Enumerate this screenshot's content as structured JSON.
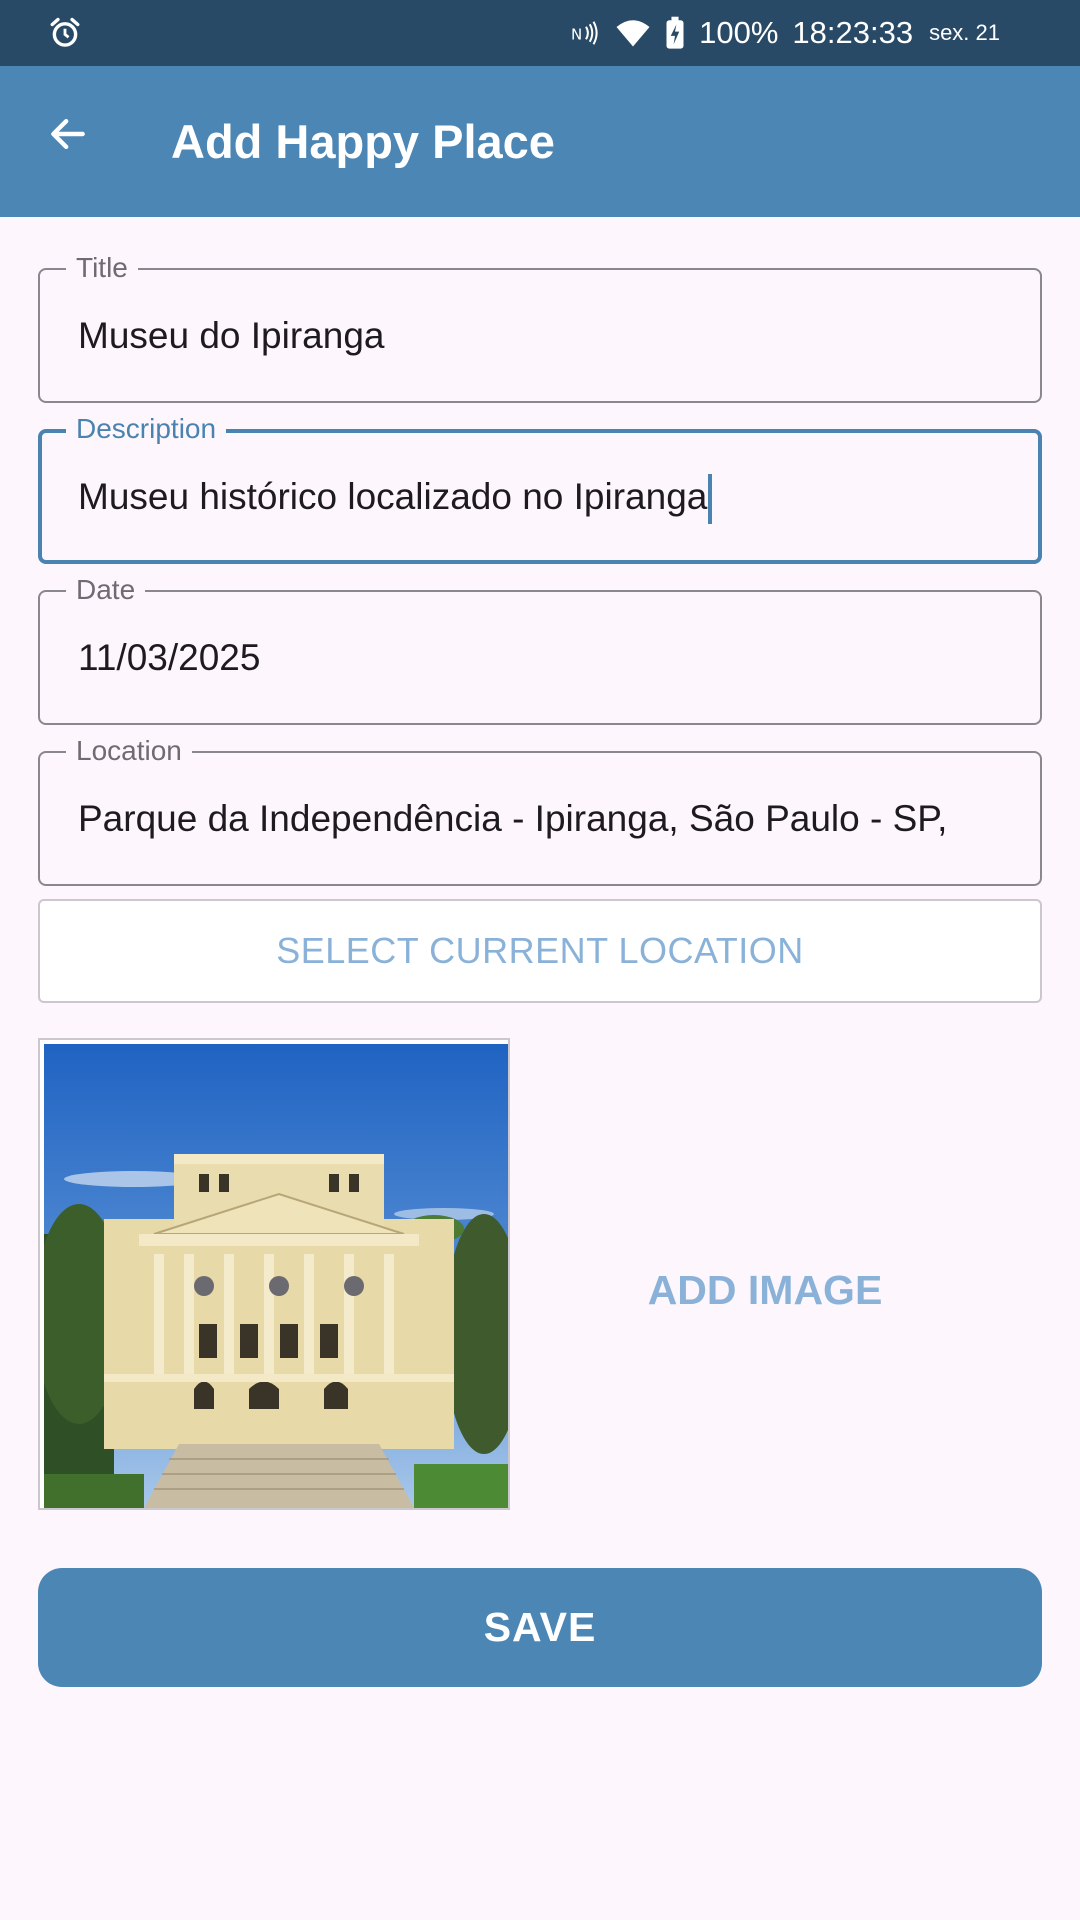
{
  "status_bar": {
    "time": "18:23:33",
    "date": "sex. 21",
    "battery": "100%",
    "icons": [
      "alarm-icon",
      "nfc-icon",
      "wifi-icon",
      "battery-charging-icon"
    ]
  },
  "app_bar": {
    "title": "Add Happy Place",
    "back_icon": "arrow-back-icon"
  },
  "form": {
    "title": {
      "label": "Title",
      "value": "Museu do Ipiranga"
    },
    "description": {
      "label": "Description",
      "value": "Museu histórico localizado no Ipiranga"
    },
    "date": {
      "label": "Date",
      "value": "11/03/2025"
    },
    "location": {
      "label": "Location",
      "value": "Parque da Independência - Ipiranga, São Paulo - SP,"
    }
  },
  "buttons": {
    "select_location": "SELECT CURRENT LOCATION",
    "add_image": "ADD IMAGE",
    "save": "SAVE"
  },
  "colors": {
    "status_bar": "#294a66",
    "primary": "#4c86b4",
    "primary_light": "#8ab2d8",
    "background": "#fdf6fc"
  }
}
